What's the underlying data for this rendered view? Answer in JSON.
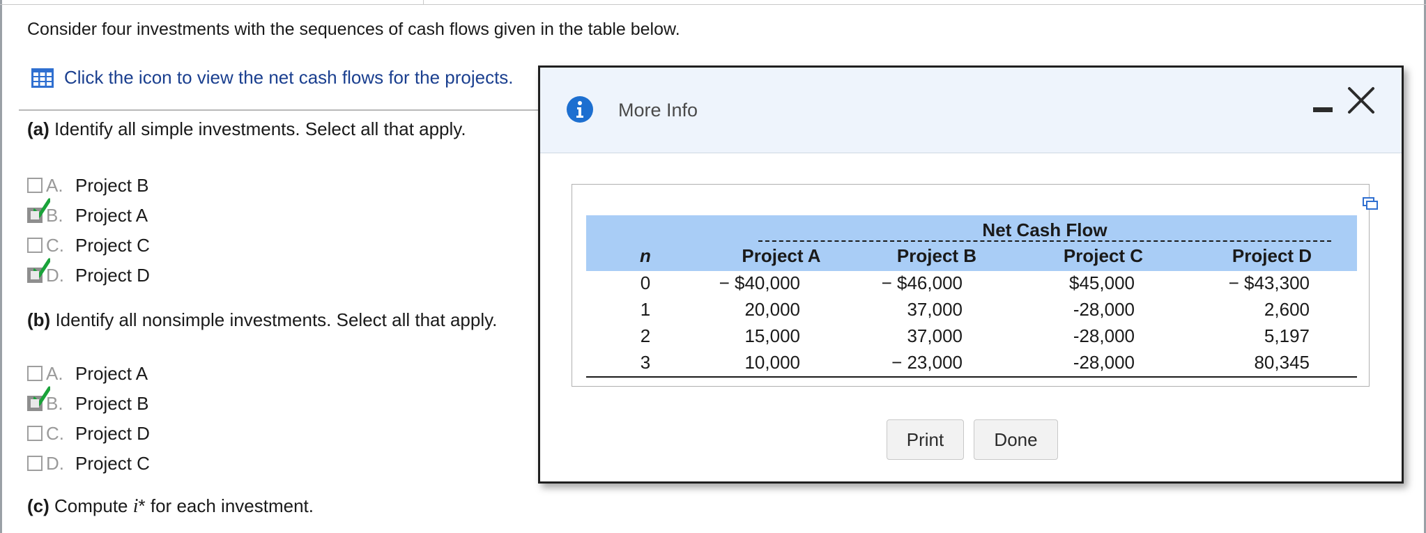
{
  "intro": "Consider four investments with the sequences of cash flows given in the table below.",
  "icon_link": "Click the icon to view the net cash flows for the projects.",
  "part_a": {
    "label": "(a)",
    "text": "Identify all simple investments. Select all that apply.",
    "options": [
      {
        "letter": "A.",
        "name": "Project B",
        "checked": false
      },
      {
        "letter": "B.",
        "name": "Project A",
        "checked": true
      },
      {
        "letter": "C.",
        "name": "Project C",
        "checked": false
      },
      {
        "letter": "D.",
        "name": "Project D",
        "checked": true
      }
    ]
  },
  "part_b": {
    "label": "(b)",
    "text": "Identify all nonsimple investments. Select all that apply.",
    "options": [
      {
        "letter": "A.",
        "name": "Project A",
        "checked": false
      },
      {
        "letter": "B.",
        "name": "Project B",
        "checked": true
      },
      {
        "letter": "C.",
        "name": "Project D",
        "checked": false
      },
      {
        "letter": "D.",
        "name": "Project C",
        "checked": false
      }
    ]
  },
  "part_c": {
    "label": "(c)",
    "text_before": "Compute ",
    "var": "i",
    "text_after": "* for each investment."
  },
  "modal": {
    "title": "More Info",
    "table": {
      "group_header": "Net Cash Flow",
      "columns": [
        "n",
        "Project A",
        "Project B",
        "Project C",
        "Project D"
      ],
      "rows": [
        [
          "0",
          "− $40,000",
          "− $46,000",
          "$45,000",
          "− $43,300"
        ],
        [
          "1",
          "20,000",
          "37,000",
          "-28,000",
          "2,600"
        ],
        [
          "2",
          "15,000",
          "37,000",
          "-28,000",
          "5,197"
        ],
        [
          "3",
          "10,000",
          "− 23,000",
          "-28,000",
          "80,345"
        ]
      ]
    },
    "buttons": {
      "print": "Print",
      "done": "Done"
    }
  },
  "colors": {
    "header_band": "#a9cdf6",
    "modal_header": "#eef4fc",
    "link": "#1a3f8f",
    "check_green": "#1aa33a",
    "info_blue": "#1d6fd0"
  }
}
